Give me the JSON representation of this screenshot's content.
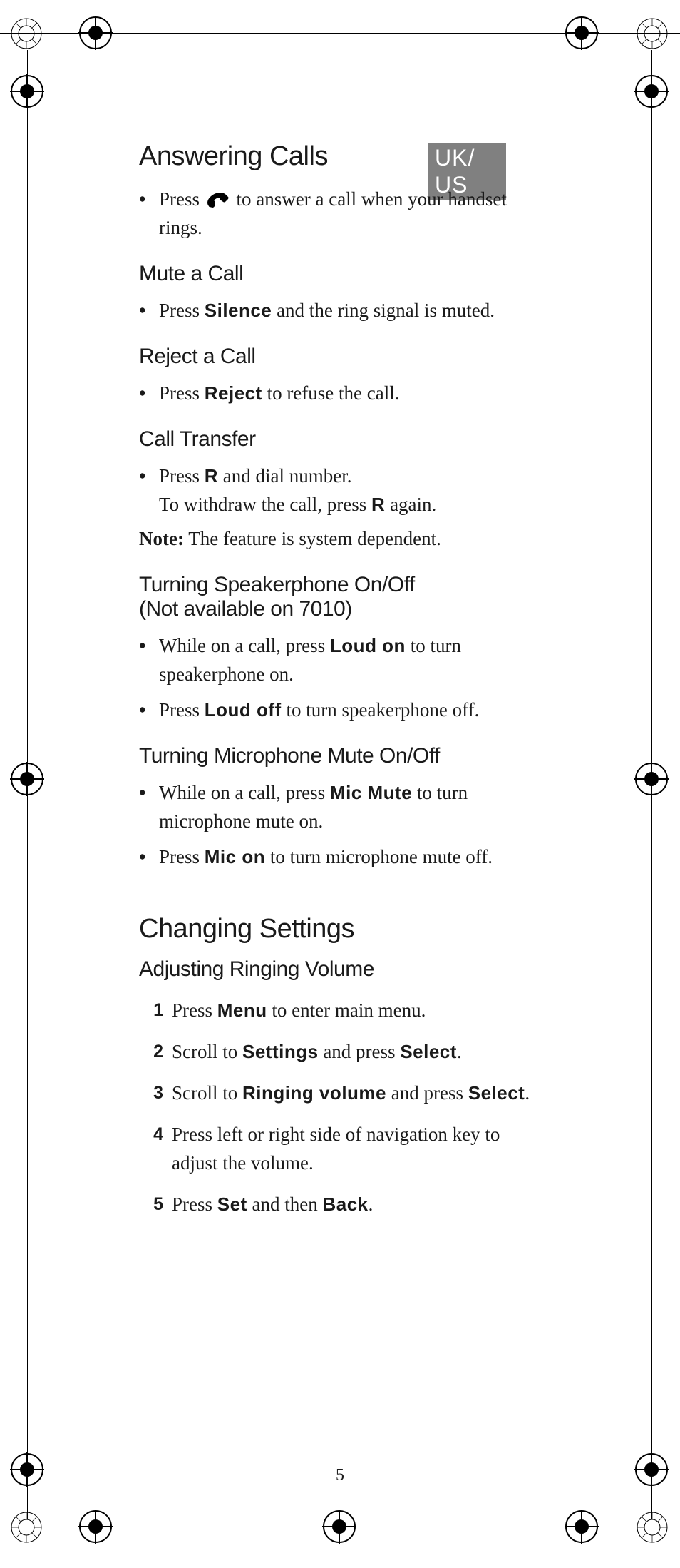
{
  "lang_badge": "UK/\nUS",
  "page_number": "5",
  "sec1": {
    "title": "Answering Calls",
    "b1a": "Press ",
    "b1b": " to answer a call when your handset rings."
  },
  "mute": {
    "title": "Mute a Call",
    "b1a": "Press ",
    "k1": "Silence",
    "b1b": " and the ring signal is muted."
  },
  "reject": {
    "title": "Reject a Call",
    "b1a": "Press ",
    "k1": "Reject",
    "b1b": " to refuse the call."
  },
  "transfer": {
    "title": "Call Transfer",
    "b1a": "Press ",
    "k1": "R",
    "b1b": " and dial number.",
    "b1c": "To withdraw the call, press ",
    "k2": "R",
    "b1d": " again.",
    "note_label": "Note:",
    "note_text": " The feature is system dependent."
  },
  "speaker": {
    "title_l1": "Turning Speakerphone On/Off",
    "title_l2": "(Not available on 7010)",
    "b1a": "While on a call, press ",
    "k1": "Loud on",
    "b1b": " to turn speakerphone on.",
    "b2a": "Press ",
    "k2": "Loud off",
    "b2b": " to turn speakerphone off."
  },
  "mic": {
    "title": "Turning Microphone Mute On/Off",
    "b1a": "While on a call, press ",
    "k1": "Mic Mute",
    "b1b": " to turn microphone mute on.",
    "b2a": "Press ",
    "k2": "Mic on",
    "b2b": " to turn microphone mute off."
  },
  "sec2": {
    "title": "Changing Settings"
  },
  "ringvol": {
    "title": "Adjusting Ringing Volume",
    "steps": [
      {
        "n": "1",
        "a": "Press ",
        "k1": "Menu",
        "b": " to enter main menu."
      },
      {
        "n": "2",
        "a": "Scroll to ",
        "k1": "Settings",
        "b": " and press ",
        "k2": "Select",
        "c": "."
      },
      {
        "n": "3",
        "a": "Scroll to ",
        "k1": "Ringing volume",
        "b": " and press ",
        "k2": "Select",
        "c": "."
      },
      {
        "n": "4",
        "a": "Press left or right side of navigation key to adjust the volume."
      },
      {
        "n": "5",
        "a": "Press ",
        "k1": "Set",
        "b": " and then ",
        "k2": "Back",
        "c": "."
      }
    ]
  }
}
